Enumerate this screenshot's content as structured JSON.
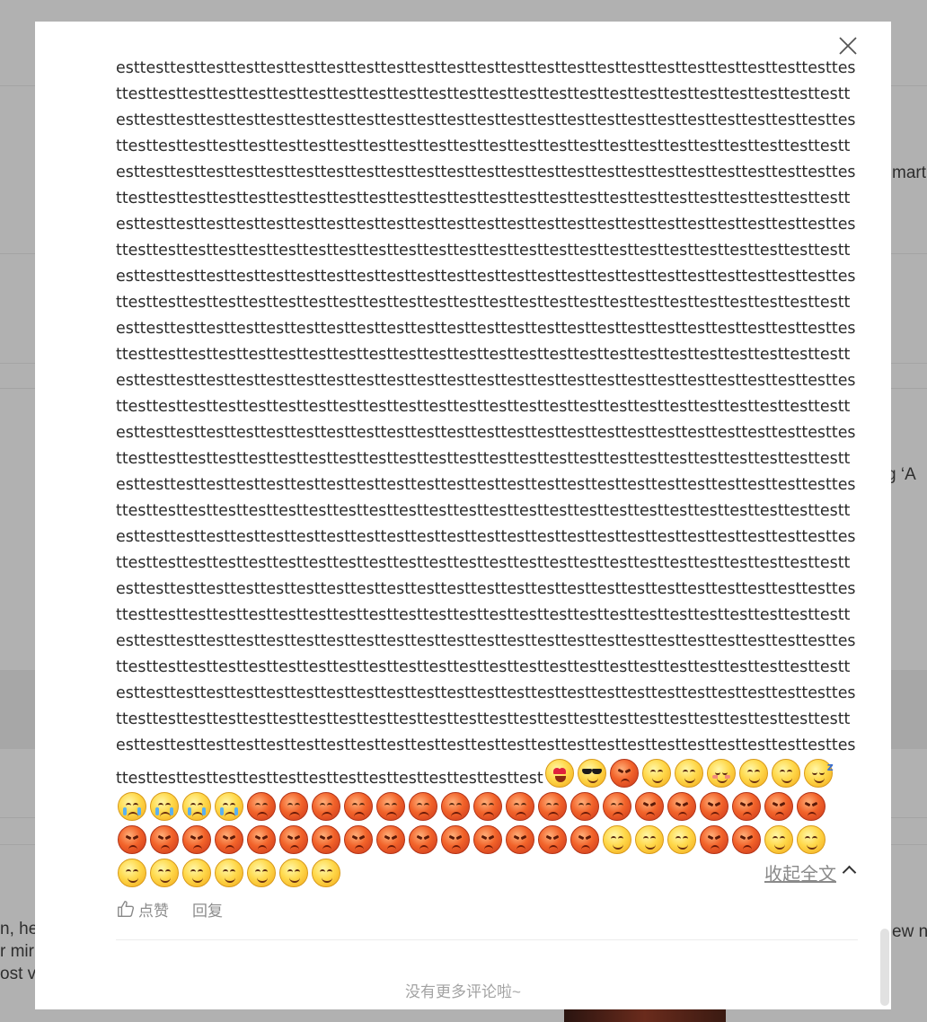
{
  "background": {
    "fragments": [
      "mart",
      "g   ‘A",
      "n, he",
      "r mir",
      "ost v",
      "ew n"
    ]
  },
  "modal": {
    "comment_text": "esttesttesttesttesttesttesttesttesttesttesttesttesttesttesttesttesttesttesttesttesttesttesttesttesttesttesttesttesttesttesttesttesttesttesttesttesttesttesttesttesttesttesttesttesttesttesttesttesttesttesttesttesttesttesttesttesttesttesttesttesttesttesttesttesttesttesttesttesttesttesttesttesttesttesttesttesttesttesttesttesttesttesttesttesttesttesttesttesttesttesttesttesttesttesttesttesttesttesttesttesttesttesttesttesttesttesttesttesttesttesttesttesttesttesttesttesttesttesttesttesttesttesttesttesttesttesttesttesttesttesttesttesttesttesttesttesttesttesttesttesttesttesttesttesttesttesttesttesttesttesttesttesttesttesttesttesttesttesttesttesttesttesttesttesttesttesttesttesttesttesttesttesttesttesttesttesttesttesttesttesttesttesttesttesttesttesttesttesttesttesttesttesttesttesttesttesttesttesttesttesttesttesttesttesttesttesttesttesttesttesttesttesttesttesttesttesttesttesttesttesttesttesttesttesttesttesttesttesttesttesttesttesttesttesttesttesttesttesttesttesttesttesttesttesttesttesttesttesttesttesttesttesttesttesttesttesttesttesttesttesttesttesttesttesttesttesttesttesttesttesttesttesttesttesttesttesttesttesttesttesttesttesttesttesttesttesttesttesttesttesttesttesttesttesttesttesttesttesttesttesttesttesttesttesttesttesttesttesttesttesttesttesttesttesttesttesttesttesttesttesttesttesttesttesttesttesttesttesttesttesttesttesttesttesttesttesttesttesttesttesttesttesttesttesttesttesttesttesttesttesttesttesttesttesttesttesttesttesttesttesttesttesttesttesttesttesttesttesttesttesttesttesttesttesttesttesttesttesttesttesttesttesttesttesttesttesttesttesttesttesttesttesttesttesttesttesttesttesttesttesttesttesttesttesttesttesttesttesttesttesttesttesttesttesttesttesttesttesttesttesttesttesttesttesttesttesttesttesttesttesttesttesttesttesttesttesttesttesttesttesttesttesttesttesttesttesttesttesttesttesttesttesttesttesttesttesttesttesttesttesttesttesttesttesttesttesttesttesttesttesttesttesttesttesttesttesttesttesttesttesttesttesttesttesttesttesttesttesttesttesttesttesttesttesttesttesttesttesttesttesttesttesttesttesttesttesttesttesttesttesttesttesttesttesttesttesttesttesttesttesttesttesttesttesttesttesttesttesttesttesttesttesttesttesttesttesttesttesttesttesttesttesttesttesttesttesttesttesttesttesttesttesttesttesttesttesttesttesttesttesttesttesttesttesttesttesttesttesttesttesttesttesttesttesttesttesttesttesttesttesttesttesttesttesttesttesttesttesttesttesttesttesttesttesttesttesttesttesttesttesttesttesttesttesttesttesttesttesttesttesttesttesttesttesttesttesttesttesttesttesttesttesttesttesttesttesttesttesttesttesttesttesttesttesttesttesttesttesttesttesttesttesttesttesttesttesttesttesttesttesttesttesttesttesttesttesttesttesttesttesttesttesttesttesttesttesttesttesttesttesttesttesttesttesttest",
    "emojis": [
      "love-emoji",
      "cool-emoji",
      "angry-emoji",
      "smile-emoji",
      "smile-emoji",
      "shy-emoji",
      "smile-emoji",
      "smile-emoji",
      "sleepy-emoji",
      "cry-emoji",
      "cry-emoji",
      "cry-emoji",
      "cry-emoji",
      "sad-emoji",
      "sad-emoji",
      "sad-emoji",
      "sad-emoji",
      "sad-emoji",
      "sad-emoji",
      "sad-emoji",
      "sad-emoji",
      "sad-emoji",
      "sad-emoji",
      "sad-emoji",
      "sad-emoji",
      "angry-emoji",
      "angry-emoji",
      "angry-emoji",
      "angry-emoji",
      "angry-emoji",
      "angry-emoji",
      "angry-emoji",
      "angry-emoji",
      "angry-emoji",
      "angry-emoji",
      "angry-emoji",
      "angry-emoji",
      "angry-emoji",
      "angry-emoji",
      "angry-emoji",
      "angry-emoji",
      "angry-emoji",
      "angry-emoji",
      "angry-emoji",
      "angry-emoji",
      "angry-emoji",
      "smile-emoji",
      "smile-emoji",
      "smile-emoji",
      "angry-emoji",
      "angry-emoji",
      "smile-emoji",
      "smile-emoji",
      "smile-emoji",
      "smile-emoji",
      "smile-emoji",
      "smile-emoji",
      "smile-emoji",
      "smile-emoji",
      "smile-emoji"
    ],
    "collapse_label": "收起全文",
    "like_label": "点赞",
    "reply_label": "回复",
    "no_more_label": "没有更多评论啦~"
  },
  "colors": {
    "overlay": "#b1b1b1",
    "link_gray": "#8a8a8a",
    "text": "#2b2b2b"
  }
}
